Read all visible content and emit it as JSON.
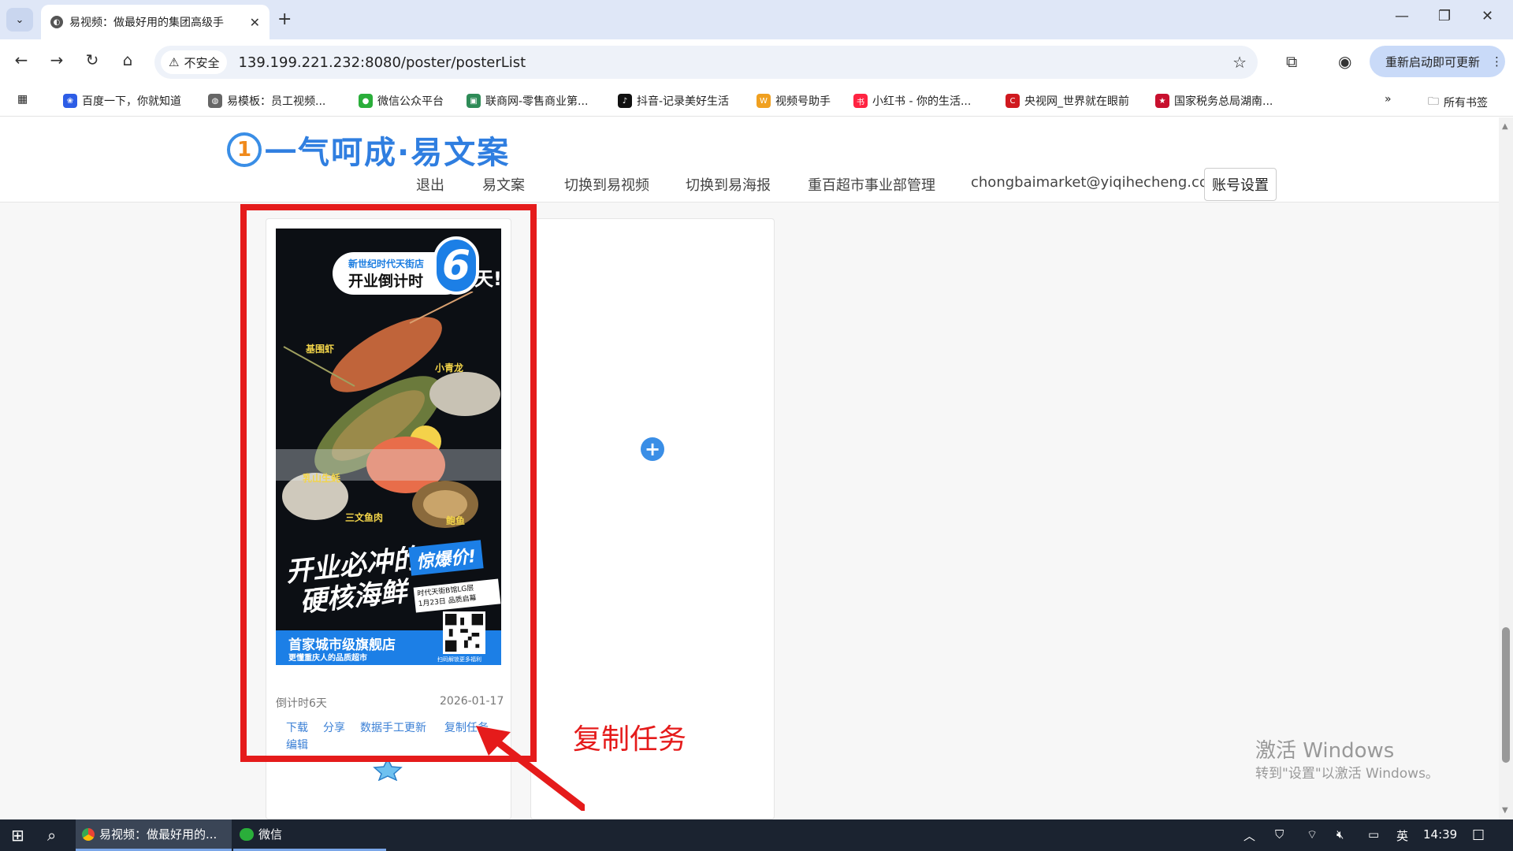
{
  "browser": {
    "tab_title": "易视频：做最好用的集团高级手",
    "url": "139.199.221.232:8080/poster/posterList",
    "security_label": "不安全",
    "update_label": "重新启动即可更新",
    "bookmarks": [
      "百度一下，你就知道",
      "易模板：员工视频...",
      "微信公众平台",
      "联商网-零售商业第...",
      "抖音-记录美好生活",
      "视频号助手",
      "小红书 - 你的生活...",
      "央视网_世界就在眼前",
      "国家税务总局湖南..."
    ],
    "all_bookmarks": "所有书签"
  },
  "site": {
    "logo_text": "一气呵成·易文案",
    "logo_mark": "1",
    "nav": [
      "退出",
      "易文案",
      "切换到易视频",
      "切换到易海报",
      "重百超市事业部管理",
      "chongbaimarket@yiqihecheng.cc"
    ],
    "account_button": "账号设置"
  },
  "poster": {
    "store_line": "新世纪时代天街店",
    "countdown_line": "开业倒计时",
    "countdown_number": "6",
    "countdown_unit": "天!",
    "labels": [
      "基围虾",
      "小青龙",
      "乳山生蚝",
      "三文鱼肉",
      "鲍鱼"
    ],
    "headline_1": "开业必冲的",
    "headline_2": "硬核海鲜",
    "boom": "惊爆价!",
    "info_1": "时代天街B馆LG层",
    "info_2": "1月23日 品质启幕",
    "footer_1": "首家城市级旗舰店",
    "footer_2": "更懂重庆人的品质超市",
    "qr_caption": "扫码解锁更多福利"
  },
  "card": {
    "status": "倒计时6天",
    "date": "2026-01-17",
    "actions": [
      "下载",
      "分享",
      "数据手工更新",
      "复制任务"
    ],
    "edit": "编辑"
  },
  "annotation": {
    "label": "复制任务"
  },
  "watermark": {
    "line1": "激活 Windows",
    "line2": "转到\"设置\"以激活 Windows。"
  },
  "taskbar": {
    "chrome_item": "易视频：做最好用的...",
    "wechat_item": "微信",
    "ime": "英",
    "time": "14:39"
  },
  "colors": {
    "brand_blue": "#2f7ee0",
    "annotation_red": "#e51b1b",
    "link_blue": "#3a7fd5"
  }
}
